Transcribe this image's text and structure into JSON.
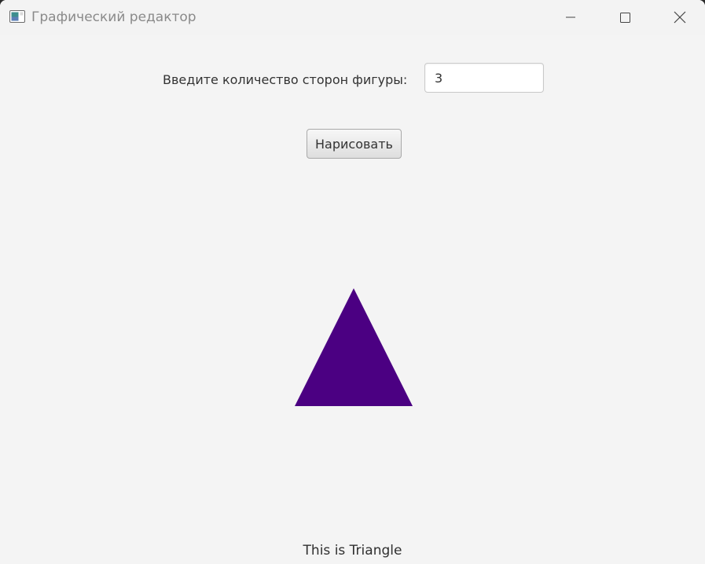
{
  "window": {
    "title": "Графический редактор",
    "icon": "java-app-icon",
    "controls": [
      "minimize-icon",
      "maximize-icon",
      "close-icon"
    ]
  },
  "form": {
    "sides_label": "Введите количество сторон фигуры:",
    "sides_value": "3",
    "draw_button_label": "Нарисовать"
  },
  "shape": {
    "sides": 3,
    "fill_color": "#4b0082"
  },
  "status": {
    "text": "This is Triangle"
  }
}
